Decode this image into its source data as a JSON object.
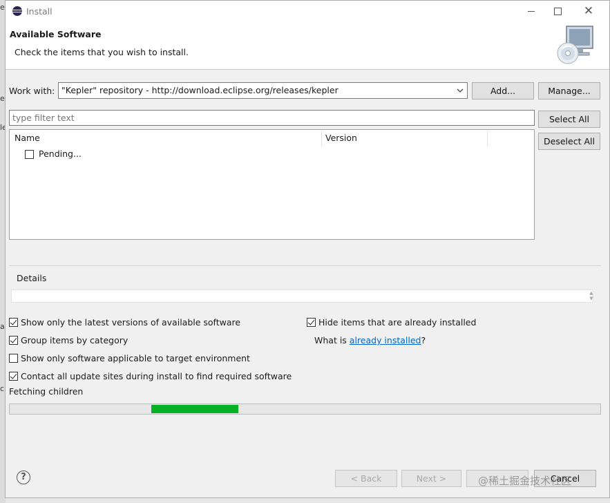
{
  "window": {
    "title": "Install",
    "minimize_glyph": "",
    "maximize_glyph": "",
    "close_glyph": "✕"
  },
  "header": {
    "title": "Available Software",
    "subtitle": "Check the items that you wish to install."
  },
  "work_with": {
    "label": "Work with:",
    "value": "\"Kepler\" repository - http://download.eclipse.org/releases/kepler",
    "add_label": "Add...",
    "manage_label": "Manage..."
  },
  "filter": {
    "placeholder": "type filter text",
    "select_all_label": "Select All",
    "deselect_all_label": "Deselect All"
  },
  "table": {
    "columns": [
      "Name",
      "Version"
    ],
    "rows": [
      {
        "label": "Pending...",
        "checked": false
      }
    ]
  },
  "details": {
    "label": "Details"
  },
  "options": {
    "show_latest": {
      "label": "Show only the latest versions of available software",
      "checked": true
    },
    "group_by_category": {
      "label": "Group items by category",
      "checked": true
    },
    "applicable_only": {
      "label": "Show only software applicable to target environment",
      "checked": false
    },
    "contact_sites": {
      "label": "Contact all update sites during install to find required software",
      "checked": true
    },
    "hide_installed": {
      "label": "Hide items that are already installed",
      "checked": true
    },
    "what_is_prefix": "What is ",
    "what_is_link": "already installed",
    "what_is_suffix": "?"
  },
  "status": {
    "text": "Fetching children",
    "progress_fraction": 0.147
  },
  "footer": {
    "help_glyph": "?",
    "back_label": "< Back",
    "next_label": "Next >",
    "finish_label": "",
    "cancel_label": "Cancel"
  },
  "watermark": "@稀土掘金技术社区",
  "background_fragments": [
    "e",
    "er",
    "le",
    "a",
    "c"
  ],
  "colors": {
    "progress": "#06b025",
    "link": "#0066cc",
    "dialog_bg": "#f0f0f0"
  },
  "icons": [
    "eclipse-icon",
    "install-cd-monitor-icon",
    "dropdown-chevron-icon",
    "help-icon"
  ]
}
